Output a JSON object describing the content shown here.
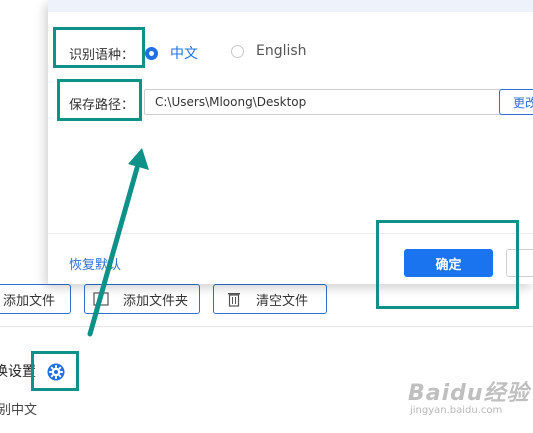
{
  "dialog": {
    "language_label": "识别语种：",
    "language_options": [
      {
        "label": "中文",
        "selected": true
      },
      {
        "label": "English",
        "selected": false
      }
    ],
    "save_path_label": "保存路径：",
    "save_path_value": "C:\\Users\\Mloong\\Desktop",
    "change_button": "更改",
    "restore_default": "恢复默认",
    "confirm_button": "确定"
  },
  "toolbar": {
    "add_file": "添加文件",
    "add_folder": "添加文件夹",
    "clear_files": "清空文件"
  },
  "settings": {
    "title": "换设置",
    "language_value": "别中文"
  },
  "watermark": {
    "brand": "Baidu经验",
    "domain": "jingyan.baidu.com"
  },
  "colors": {
    "accent": "#1a74f0",
    "annotation": "#0e9188",
    "link": "#2f6fd0"
  }
}
